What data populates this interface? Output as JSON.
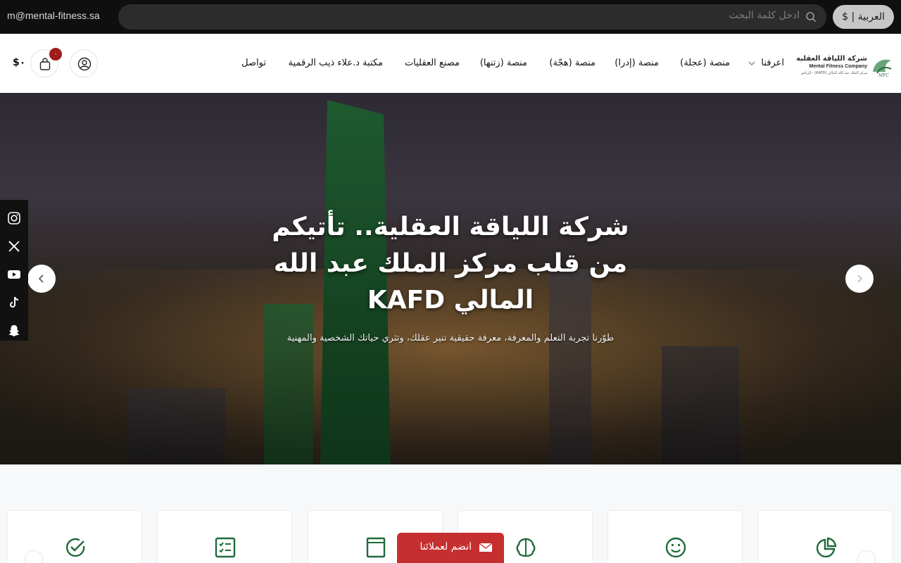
{
  "topbar": {
    "email": "m@mental-fitness.sa",
    "search_placeholder": "ادخل كلمة البحث",
    "language_currency": "العربية | $"
  },
  "header": {
    "logo": {
      "name_ar": "شركة اللياقة العقلية",
      "name_en": "Mental Fitness Company",
      "sub": "مركز الملك عبد الله المالي (KAFD) - الرياض"
    },
    "nav": [
      {
        "label": "اعرفنا",
        "has_dropdown": true
      },
      {
        "label": "منصة (عجلة)"
      },
      {
        "label": "منصة (إدرا)"
      },
      {
        "label": "منصة (هجّة)"
      },
      {
        "label": "منصة (زتنها)"
      },
      {
        "label": "مصنع العقليات"
      },
      {
        "label": "مكتبة د.علاء ذيب الرقمية"
      },
      {
        "label": "تواصل"
      }
    ],
    "cart_count": "٠",
    "cart_total": "$٠"
  },
  "hero": {
    "title_line1": "شركة اللياقة العقلية.. تأتيكم",
    "title_line2": "من قلب مركز الملك عبد الله",
    "title_line3": "المالي KAFD",
    "subtitle": "طوّرنا تجربة التعلم والمعرفة، معرفة حقيقية تنير عقلك، وتثري حياتك الشخصية والمهنية"
  },
  "social": [
    "instagram-icon",
    "x-icon",
    "youtube-icon",
    "tiktok-icon",
    "snapchat-icon"
  ],
  "join_button": "انضم لعملائنا",
  "colors": {
    "accent_green": "#1f6b3a",
    "join_red": "#c62f2f",
    "topbar_bg": "#0f0f0f"
  }
}
